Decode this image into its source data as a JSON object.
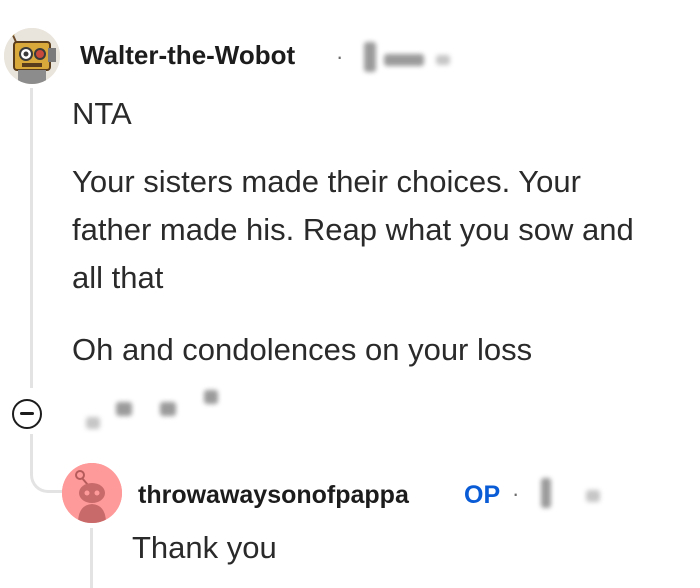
{
  "comment": {
    "username": "Walter-the-Wobot",
    "separator": "·",
    "paragraphs": [
      "NTA",
      "Your sisters made their choices. Your",
      "father made his. Reap what you sow and",
      "all that",
      "Oh and condolences on your loss"
    ]
  },
  "reply": {
    "username": "throwawaysonofpappa",
    "op_badge": "OP",
    "separator": "·",
    "text": "Thank you"
  },
  "colors": {
    "op_badge": "#0a5bd6",
    "snoo_avatar_bg": "#ff9a9a",
    "thread_line": "#e3e3e3"
  }
}
